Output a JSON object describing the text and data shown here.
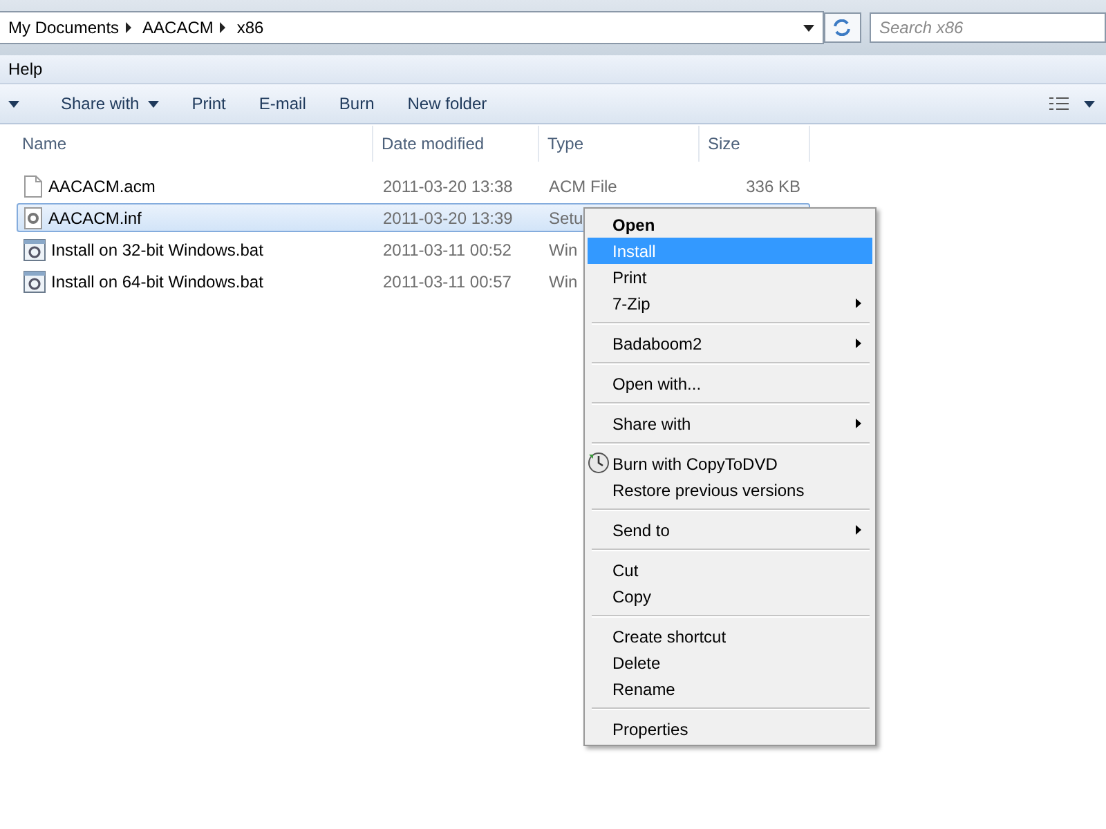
{
  "address_bar": {
    "crumbs": [
      "My Documents",
      "AACACM",
      "x86"
    ]
  },
  "search": {
    "placeholder": "Search x86"
  },
  "menu_bar": [
    "Help"
  ],
  "toolbar": [
    {
      "label": "Share with",
      "dropdown": true
    },
    {
      "label": "Print",
      "dropdown": false
    },
    {
      "label": "E-mail",
      "dropdown": false
    },
    {
      "label": "Burn",
      "dropdown": false
    },
    {
      "label": "New folder",
      "dropdown": false
    }
  ],
  "columns": [
    "Name",
    "Date modified",
    "Type",
    "Size"
  ],
  "files": [
    {
      "name": "AACACM.acm",
      "kind": "document",
      "date": "2011-03-20 13:38",
      "type": "ACM File",
      "size": "336 KB",
      "selected": false
    },
    {
      "name": "AACACM.inf",
      "kind": "settings",
      "date": "2011-03-20 13:39",
      "type": "Setu",
      "selected": true
    },
    {
      "name": "Install on 32-bit Windows.bat",
      "kind": "batch",
      "date": "2011-03-11 00:52",
      "type": "Win",
      "selected": false
    },
    {
      "name": "Install on 64-bit Windows.bat",
      "kind": "batch",
      "date": "2011-03-11 00:57",
      "type": "Win",
      "selected": false
    }
  ],
  "context_menu": [
    [
      {
        "label": "Open",
        "default": true,
        "selected": false,
        "submenu": false
      },
      {
        "label": "Install",
        "default": false,
        "selected": true,
        "submenu": false
      },
      {
        "label": "Print",
        "default": false,
        "selected": false,
        "submenu": false
      },
      {
        "label": "7-Zip",
        "default": false,
        "selected": false,
        "submenu": true
      }
    ],
    [
      {
        "label": "Badaboom2",
        "default": false,
        "selected": false,
        "submenu": true
      }
    ],
    [
      {
        "label": "Open with...",
        "default": false,
        "selected": false,
        "submenu": false
      }
    ],
    [
      {
        "label": "Share with",
        "default": false,
        "selected": false,
        "submenu": true
      }
    ],
    [
      {
        "label": "Burn with CopyToDVD",
        "default": false,
        "selected": false,
        "submenu": false,
        "icon": true
      },
      {
        "label": "Restore previous versions",
        "default": false,
        "selected": false,
        "submenu": false
      }
    ],
    [
      {
        "label": "Send to",
        "default": false,
        "selected": false,
        "submenu": true
      }
    ],
    [
      {
        "label": "Cut",
        "default": false,
        "selected": false,
        "submenu": false
      },
      {
        "label": "Copy",
        "default": false,
        "selected": false,
        "submenu": false
      }
    ],
    [
      {
        "label": "Create shortcut",
        "default": false,
        "selected": false,
        "submenu": false
      },
      {
        "label": "Delete",
        "default": false,
        "selected": false,
        "submenu": false
      },
      {
        "label": "Rename",
        "default": false,
        "selected": false,
        "submenu": false
      }
    ],
    [
      {
        "label": "Properties",
        "default": false,
        "selected": false,
        "submenu": false
      }
    ]
  ]
}
